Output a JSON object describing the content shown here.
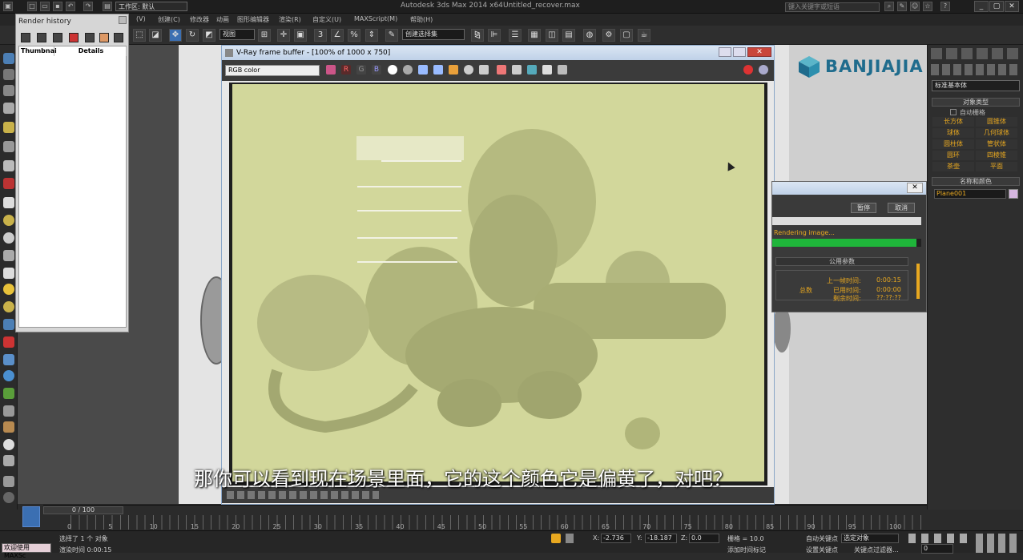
{
  "window": {
    "title": "Autodesk 3ds Max  2014 x64",
    "file": "Untitled_recover.max",
    "workspace": "工作区: 默认",
    "search_placeholder": "键入关键字或短语"
  },
  "menu": [
    "(V)",
    "创建(C)",
    "修改器",
    "动画",
    "图形编辑器",
    "渲染(R)",
    "自定义(U)",
    "MAXScript(M)",
    "帮助(H)"
  ],
  "toolbar": {
    "view_select": "视图",
    "selection_set": "创建选择集",
    "snap_label": "3"
  },
  "render_history": {
    "title": "Render history",
    "col_thumbnail": "Thumbnai",
    "col_details": "Details"
  },
  "vfb": {
    "title": "V-Ray frame buffer - [100% of 1000 x 750]",
    "channel": "RGB color",
    "btn_r": "R",
    "btn_g": "G",
    "btn_b": "B"
  },
  "progress": {
    "pause": "暂停",
    "cancel": "取消",
    "status": "Rendering image...",
    "params_header": "公用参数",
    "last_frame_label": "上一帧时间:",
    "last_frame_value": "0:00:15",
    "elapsed_label": "已用时间:",
    "elapsed_value": "0:00:00",
    "total_label": "总数",
    "remaining_label": "剩余时间:",
    "remaining_value": "??:??:??",
    "progress": 0.97
  },
  "brand": {
    "name": "BANJIAJIA",
    "color": "#1f6c8d"
  },
  "command_panel": {
    "category": "标准基本体",
    "object_type_header": "对象类型",
    "autogrid": "自动栅格",
    "objects": [
      "长方体",
      "圆锥体",
      "球体",
      "几何球体",
      "圆柱体",
      "管状体",
      "圆环",
      "四棱锥",
      "茶壶",
      "平面"
    ],
    "name_color_header": "名称和颜色",
    "object_name": "Plane001"
  },
  "timeline": {
    "frame_label": "0 / 100",
    "ticks": [
      "0",
      "5",
      "10",
      "15",
      "20",
      "25",
      "30",
      "35",
      "40",
      "45",
      "50",
      "55",
      "60",
      "65",
      "70",
      "75",
      "80",
      "85",
      "90",
      "95",
      "100"
    ]
  },
  "status": {
    "welcome": "欢迎使用 MAXSc",
    "selection": "选择了 1 个 对象",
    "render_time": "渲染时间  0:00:15",
    "x_label": "X:",
    "x_value": "-2.736",
    "y_label": "Y:",
    "y_value": "-18.187",
    "z_label": "Z:",
    "z_value": "0.0",
    "grid": "栅格 = 10.0",
    "add_time_tag": "添加时间标记",
    "auto_key": "自动关键点",
    "set_key": "设置关键点",
    "key_filters": "关键点过滤器...",
    "selected_object": "选定对象",
    "frame": "0"
  },
  "subtitle": "那你可以看到现在场景里面，它的这个颜色它是偏黄了，对吧？"
}
